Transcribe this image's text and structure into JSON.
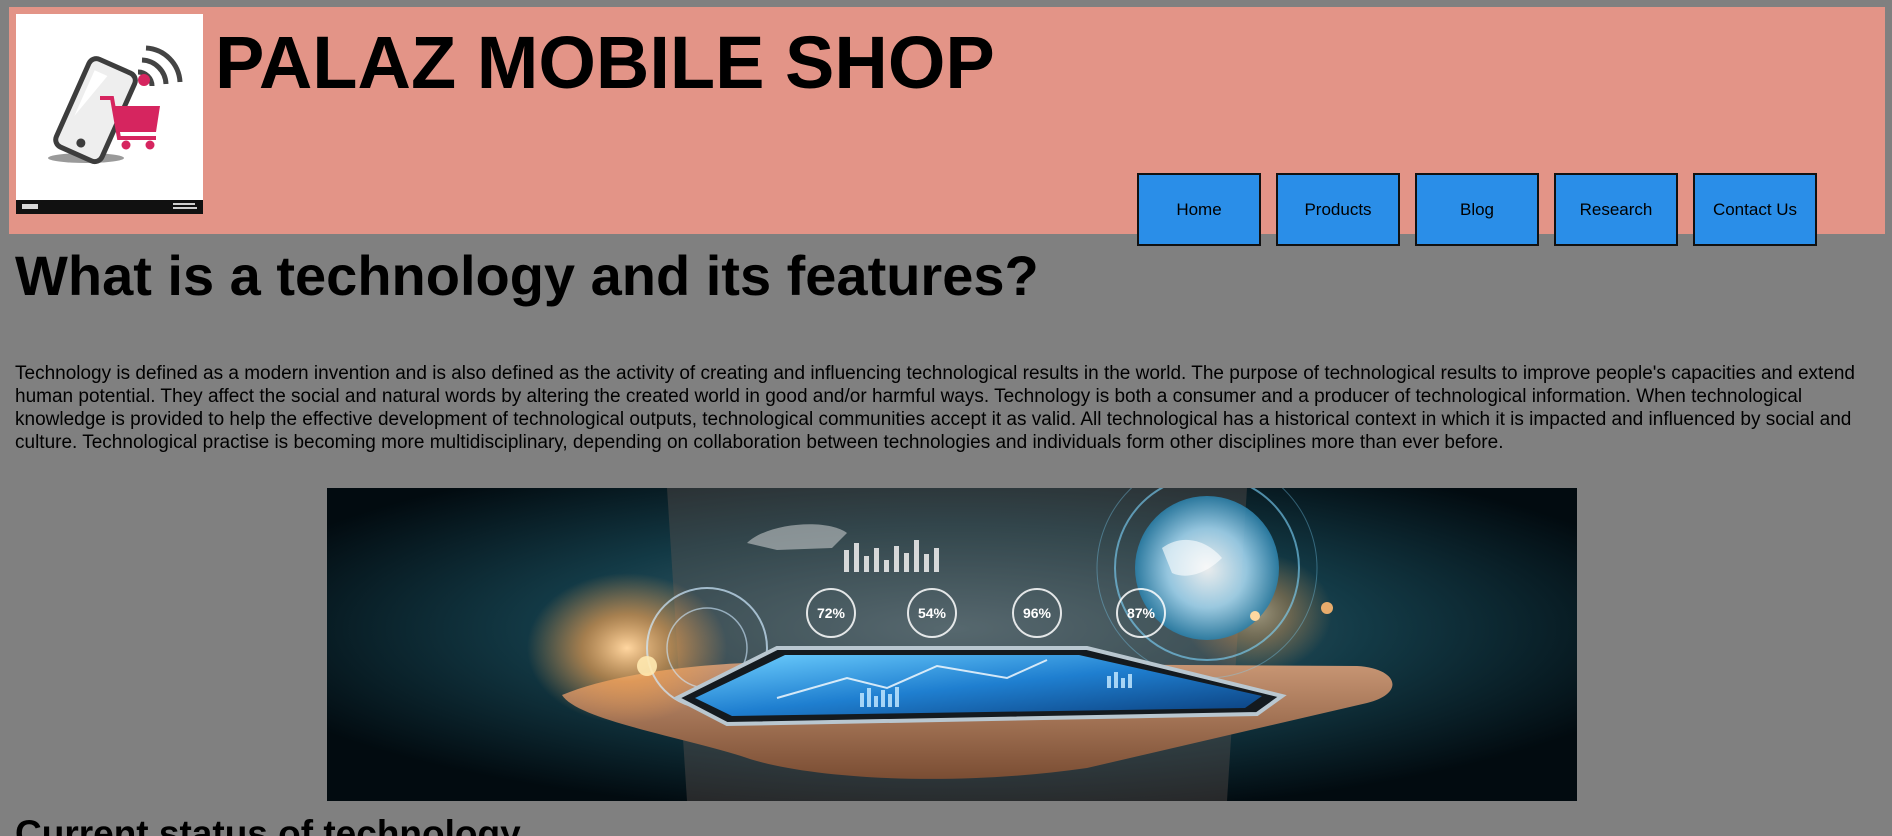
{
  "site": {
    "title": "PALAZ MOBILE SHOP"
  },
  "nav": {
    "items": [
      {
        "label": "Home"
      },
      {
        "label": "Products"
      },
      {
        "label": "Blog"
      },
      {
        "label": "Research"
      },
      {
        "label": "Contact Us"
      }
    ]
  },
  "article": {
    "heading": "What is a technology and its features?",
    "paragraph": "Technology is defined as a modern invention and is also defined as the activity of creating and influencing technological results in the world. The purpose of technological results to improve people's capacities and extend human potential. They affect the social and natural words by altering the created world in good and/or harmful ways. Technology is both a consumer and a producer of technological information. When technological knowledge is provided to help the effective development of technological outputs, technological communities accept it as valid. All technological has a historical context in which it is impacted and influenced by social and culture. Technological practise is becoming more multidisciplinary, depending on collaboration between technologies and individuals form other disciplines more than ever before.",
    "hero_stats": [
      "72%",
      "54%",
      "96%",
      "87%"
    ],
    "subheading": "Current status of technology"
  },
  "colors": {
    "page_background": "#808080",
    "header_background": "#e39487",
    "nav_button": "#2a8ee8",
    "logo_accent": "#d6255f"
  },
  "icons": {
    "logo": "phone-shopping-cart-logo"
  }
}
